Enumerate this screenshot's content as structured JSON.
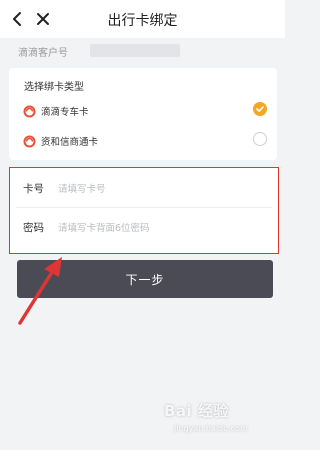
{
  "header": {
    "title": "出行卡绑定"
  },
  "customer": {
    "label": "滴滴客户号"
  },
  "card_type": {
    "label": "选择绑卡类型",
    "options": [
      {
        "label": "滴滴专车卡",
        "selected": true
      },
      {
        "label": "资和信商通卡",
        "selected": false
      }
    ]
  },
  "form": {
    "card_number": {
      "label": "卡号",
      "placeholder": "请填写卡号"
    },
    "password": {
      "label": "密码",
      "placeholder": "请填写卡背面6位密码"
    }
  },
  "actions": {
    "next_label": "下一步"
  },
  "colors": {
    "accent": "#f5a623",
    "button": "#4a4b55",
    "highlight": "#e03535",
    "brand": "#e8523a"
  },
  "icons": {
    "back": "back-icon",
    "close": "close-icon",
    "brand": "didi-logo-icon"
  },
  "watermark": {
    "text": "Bai 经验",
    "sub": "jingyan.baidu.com"
  }
}
